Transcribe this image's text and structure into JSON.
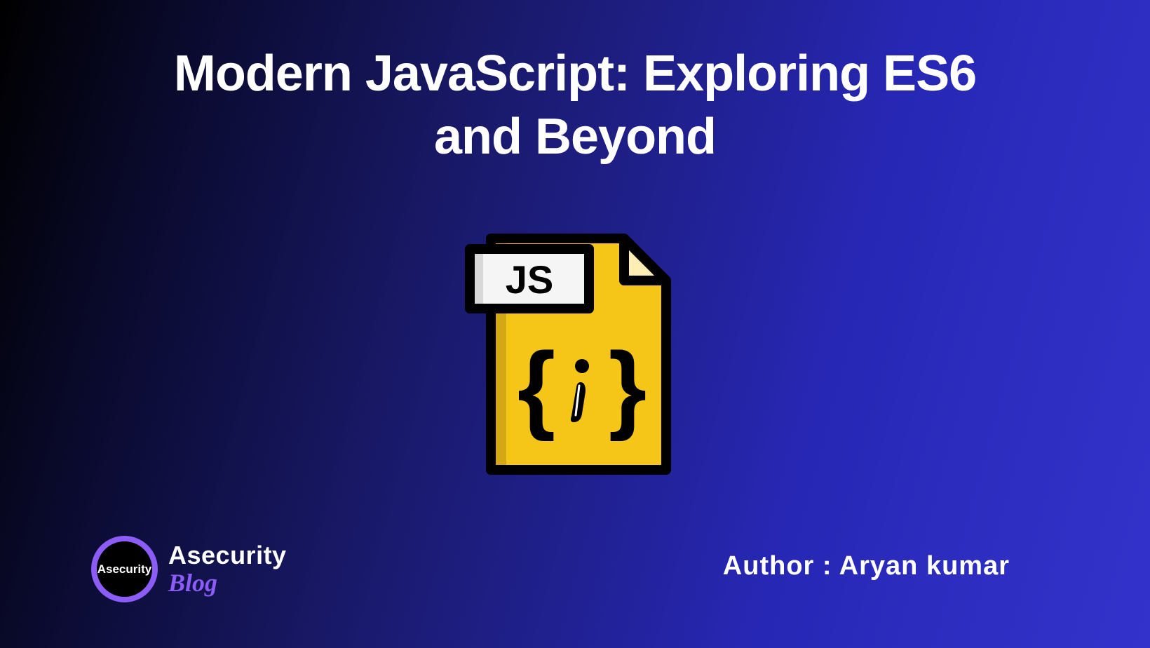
{
  "title": "Modern JavaScript: Exploring ES6 and Beyond",
  "jsLabel": "JS",
  "logo": {
    "circleText": "Asecurity",
    "topText": "Asecurity",
    "bottomText": "Blog"
  },
  "authorLabel": "Author : Aryan kumar"
}
